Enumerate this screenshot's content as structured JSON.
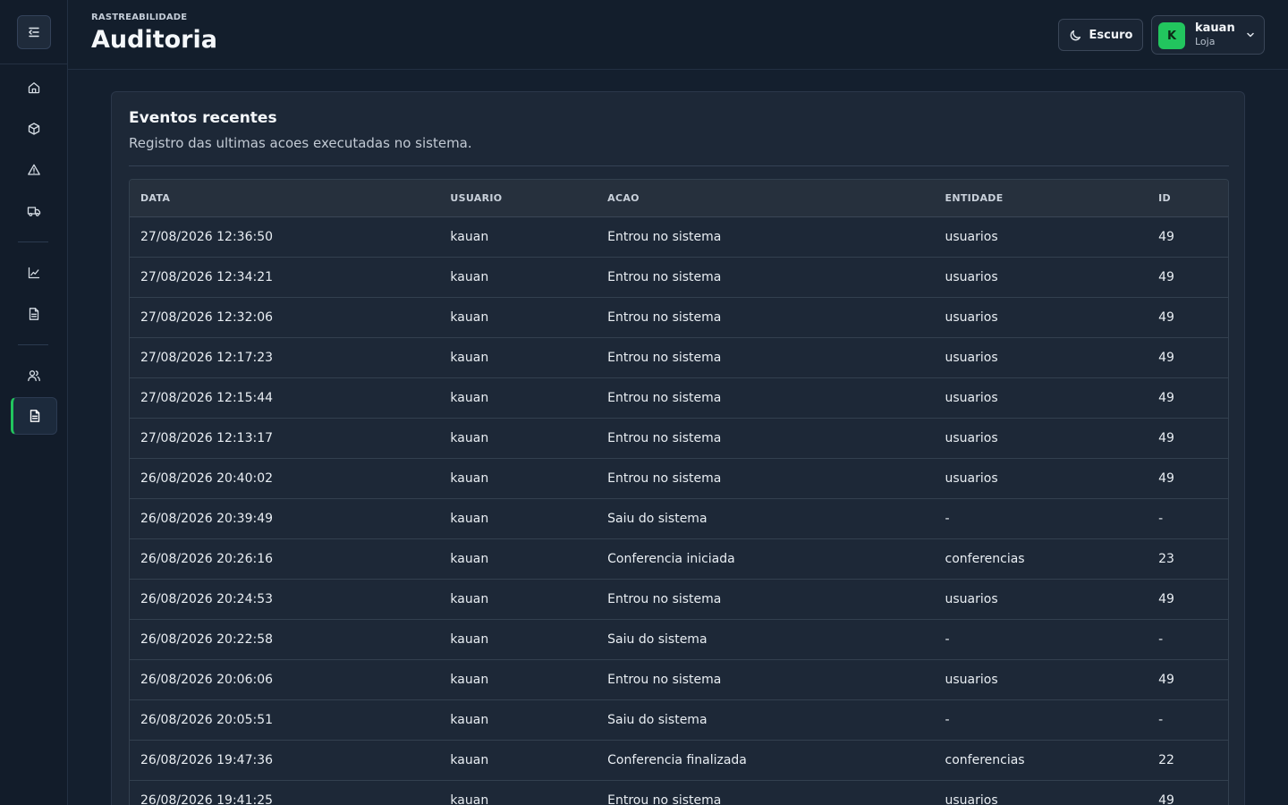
{
  "header": {
    "eyebrow": "RASTREABILIDADE",
    "title": "Auditoria",
    "theme_label": "Escuro",
    "user": {
      "initial": "K",
      "name": "kauan",
      "role": "Loja"
    }
  },
  "sidebar": {
    "items": [
      {
        "name": "home",
        "icon": "home-icon"
      },
      {
        "name": "products",
        "icon": "box-icon"
      },
      {
        "name": "alerts",
        "icon": "alert-icon"
      },
      {
        "name": "deliveries",
        "icon": "truck-icon"
      },
      {
        "name": "reports",
        "icon": "chart-icon"
      },
      {
        "name": "documents",
        "icon": "document-icon"
      },
      {
        "name": "users",
        "icon": "users-icon"
      },
      {
        "name": "audit",
        "icon": "audit-document-icon",
        "active": true
      }
    ]
  },
  "card": {
    "title": "Eventos recentes",
    "subtitle": "Registro das ultimas acoes executadas no sistema."
  },
  "table": {
    "headers": [
      "DATA",
      "USUARIO",
      "ACAO",
      "ENTIDADE",
      "ID"
    ],
    "rows": [
      [
        "27/08/2026 12:36:50",
        "kauan",
        "Entrou no sistema",
        "usuarios",
        "49"
      ],
      [
        "27/08/2026 12:34:21",
        "kauan",
        "Entrou no sistema",
        "usuarios",
        "49"
      ],
      [
        "27/08/2026 12:32:06",
        "kauan",
        "Entrou no sistema",
        "usuarios",
        "49"
      ],
      [
        "27/08/2026 12:17:23",
        "kauan",
        "Entrou no sistema",
        "usuarios",
        "49"
      ],
      [
        "27/08/2026 12:15:44",
        "kauan",
        "Entrou no sistema",
        "usuarios",
        "49"
      ],
      [
        "27/08/2026 12:13:17",
        "kauan",
        "Entrou no sistema",
        "usuarios",
        "49"
      ],
      [
        "26/08/2026 20:40:02",
        "kauan",
        "Entrou no sistema",
        "usuarios",
        "49"
      ],
      [
        "26/08/2026 20:39:49",
        "kauan",
        "Saiu do sistema",
        "-",
        "-"
      ],
      [
        "26/08/2026 20:26:16",
        "kauan",
        "Conferencia iniciada",
        "conferencias",
        "23"
      ],
      [
        "26/08/2026 20:24:53",
        "kauan",
        "Entrou no sistema",
        "usuarios",
        "49"
      ],
      [
        "26/08/2026 20:22:58",
        "kauan",
        "Saiu do sistema",
        "-",
        "-"
      ],
      [
        "26/08/2026 20:06:06",
        "kauan",
        "Entrou no sistema",
        "usuarios",
        "49"
      ],
      [
        "26/08/2026 20:05:51",
        "kauan",
        "Saiu do sistema",
        "-",
        "-"
      ],
      [
        "26/08/2026 19:47:36",
        "kauan",
        "Conferencia finalizada",
        "conferencias",
        "22"
      ],
      [
        "26/08/2026 19:41:25",
        "kauan",
        "Entrou no sistema",
        "usuarios",
        "49"
      ]
    ]
  },
  "colors": {
    "accent": "#22c55e",
    "background": "#141f2e",
    "card": "#1d2837"
  }
}
